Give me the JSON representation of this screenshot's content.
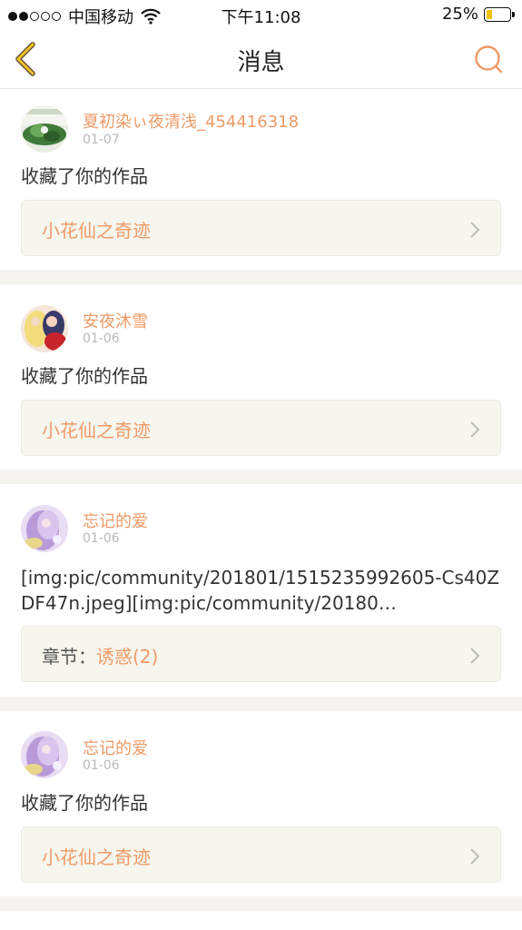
{
  "status_bar": {
    "carrier": "中国移动",
    "time": "下午11:08",
    "battery": "25%",
    "battery_level": 0.25,
    "signal_full": 2,
    "signal_total": 5
  },
  "nav": {
    "title": "消息",
    "back_icon": "chevron-left-icon",
    "search_icon": "search-icon",
    "accent": "#ef9a66"
  },
  "messages": [
    {
      "user": "夏初染ぃ夜清浅_454416318",
      "date": "01-07",
      "text": "收藏了你的作品",
      "link": {
        "prefix": "",
        "title": "小花仙之奇迹"
      }
    },
    {
      "user": "安夜沐雪",
      "date": "01-06",
      "text": "收藏了你的作品",
      "link": {
        "prefix": "",
        "title": "小花仙之奇迹"
      }
    },
    {
      "user": "忘记的爱",
      "date": "01-06",
      "text": "[img:pic/community/201801/1515235992605-Cs40ZDF47n.jpeg][img:pic/community/20180…",
      "link": {
        "prefix": "章节：",
        "title": "诱惑(2)"
      }
    },
    {
      "user": "忘记的爱",
      "date": "01-06",
      "text": "收藏了你的作品",
      "link": {
        "prefix": "",
        "title": "小花仙之奇迹"
      }
    }
  ]
}
